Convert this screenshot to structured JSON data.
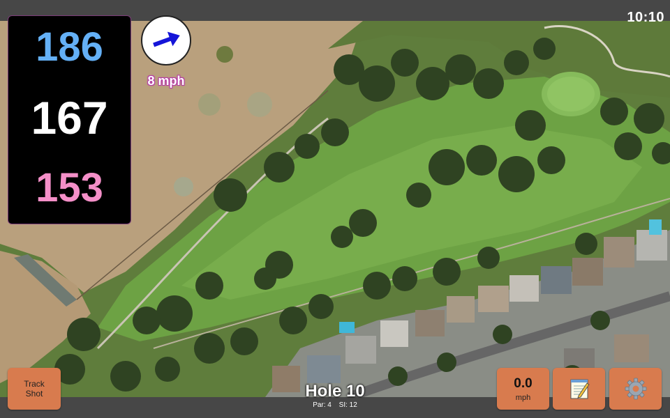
{
  "status": {
    "time": "10:10"
  },
  "distances": {
    "back": "186",
    "middle": "167",
    "front": "153"
  },
  "wind": {
    "speed_label": "8 mph",
    "readout_value": "0.0",
    "readout_unit": "mph"
  },
  "hole": {
    "title": "Hole 10",
    "par": "Par: 4",
    "si": "SI: 12"
  },
  "buttons": {
    "track_line1": "Track",
    "track_line2": "Shot"
  },
  "icons": {
    "wind": "arrow-icon",
    "notes": "notepad-icon",
    "settings": "gear-icon"
  },
  "colors": {
    "back_distance": "#64b0f6",
    "middle_distance": "#ffffff",
    "front_distance": "#f48fc8",
    "button": "#d87b4e",
    "bar": "#474747"
  }
}
